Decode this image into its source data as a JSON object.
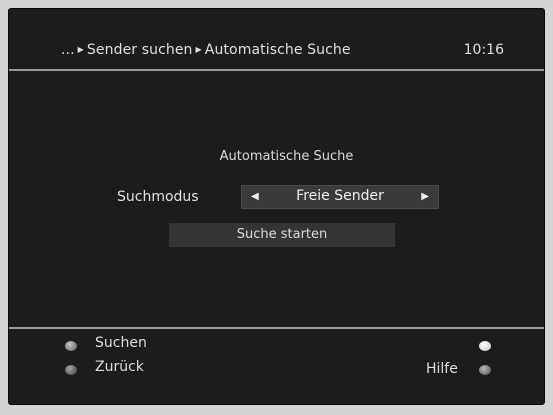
{
  "header": {
    "breadcrumb": [
      {
        "text": "...",
        "icon": "triangle-right-icon"
      },
      {
        "text": "Sender suchen",
        "icon": "triangle-right-icon"
      },
      {
        "text": "Automatische Suche"
      }
    ],
    "clock": "10:16"
  },
  "main": {
    "title": "Automatische Suche",
    "search_mode": {
      "label": "Suchmodus",
      "value": "Freie Sender",
      "left_arrow_icon": "triangle-left-icon",
      "right_arrow_icon": "triangle-right-icon"
    },
    "start_button": "Suche starten"
  },
  "footer": {
    "red": {
      "label": "Suchen",
      "color": "#c8c8c8"
    },
    "green": {
      "label": "Zurück",
      "color": "#a8a8a8"
    },
    "yellow": {
      "label": "",
      "color": "#ffffff"
    },
    "blue": {
      "label": "Hilfe",
      "color": "#bcbcbc"
    }
  },
  "colors": {
    "background": "#1c1c1c",
    "text": "#e0e0e0",
    "selector": "#3a3a3a",
    "separator": "#9a9a9a"
  }
}
